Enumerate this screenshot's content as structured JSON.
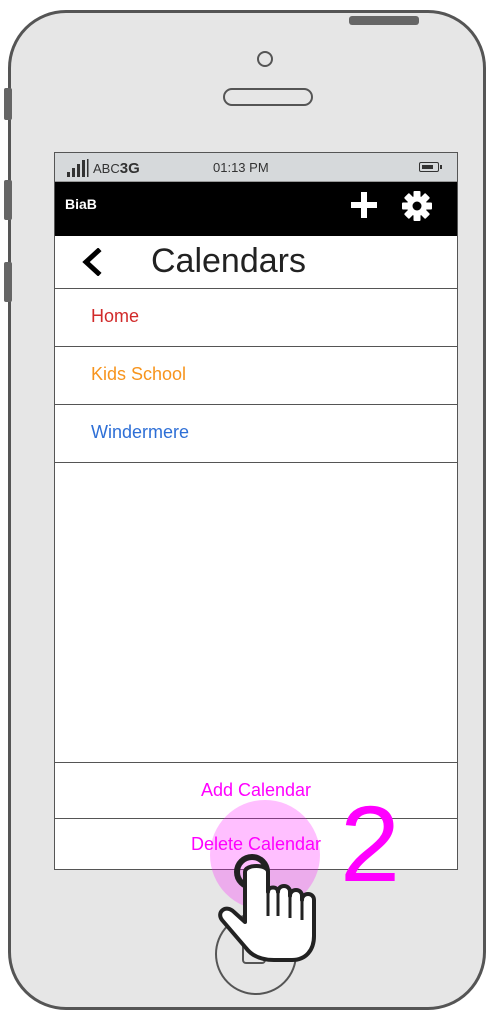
{
  "status_bar": {
    "carrier": "ABC",
    "network": "3G",
    "time": "01:13 PM"
  },
  "app_bar": {
    "app_name": "BiaB"
  },
  "header": {
    "title": "Calendars"
  },
  "calendars": [
    {
      "name": "Home",
      "color": "#d12a2a"
    },
    {
      "name": "Kids School",
      "color": "#f7941d"
    },
    {
      "name": "Windermere",
      "color": "#2e6fd6"
    }
  ],
  "actions": {
    "add_label": "Add Calendar",
    "delete_label": "Delete Calendar"
  },
  "annotation": {
    "step": "2",
    "color": "#ff00ff"
  }
}
